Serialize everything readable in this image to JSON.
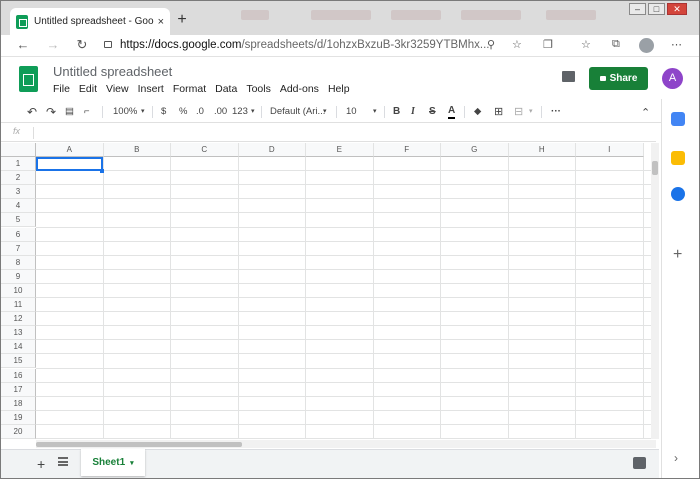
{
  "browser": {
    "tab_title": "Untitled spreadsheet - Google S",
    "tab_close": "×",
    "new_tab": "+",
    "url_host": "https://docs.google.com",
    "url_path": "/spreadsheets/d/1ohzxBxzuB-3kr3259YTBMhx..."
  },
  "doc": {
    "title": "Untitled spreadsheet",
    "menus": [
      "File",
      "Edit",
      "View",
      "Insert",
      "Format",
      "Data",
      "Tools",
      "Add-ons",
      "Help"
    ],
    "share_label": "Share",
    "account_initial": "A"
  },
  "toolbar": {
    "zoom": "100%",
    "currency": "$",
    "percent": "%",
    "decrease_decimal": ".0",
    "increase_decimal": ".00",
    "more_formats": "123",
    "font": "Default (Ari...",
    "font_size": "10",
    "bold": "B",
    "italic": "I",
    "strike": "S",
    "text_color": "A",
    "more": "···"
  },
  "formula_bar": {
    "fx": "fx"
  },
  "columns": [
    "A",
    "B",
    "C",
    "D",
    "E",
    "F",
    "G",
    "H",
    "I"
  ],
  "rows": [
    "1",
    "2",
    "3",
    "4",
    "5",
    "6",
    "7",
    "8",
    "9",
    "10",
    "11",
    "12",
    "13",
    "14",
    "15",
    "16",
    "17",
    "18",
    "19",
    "20"
  ],
  "sheets": [
    {
      "name": "Sheet1",
      "active": true
    }
  ],
  "colors": {
    "brand_green": "#0f9d58",
    "share_green": "#188038",
    "selection": "#1a73e8",
    "avatar": "#8e44c9"
  }
}
